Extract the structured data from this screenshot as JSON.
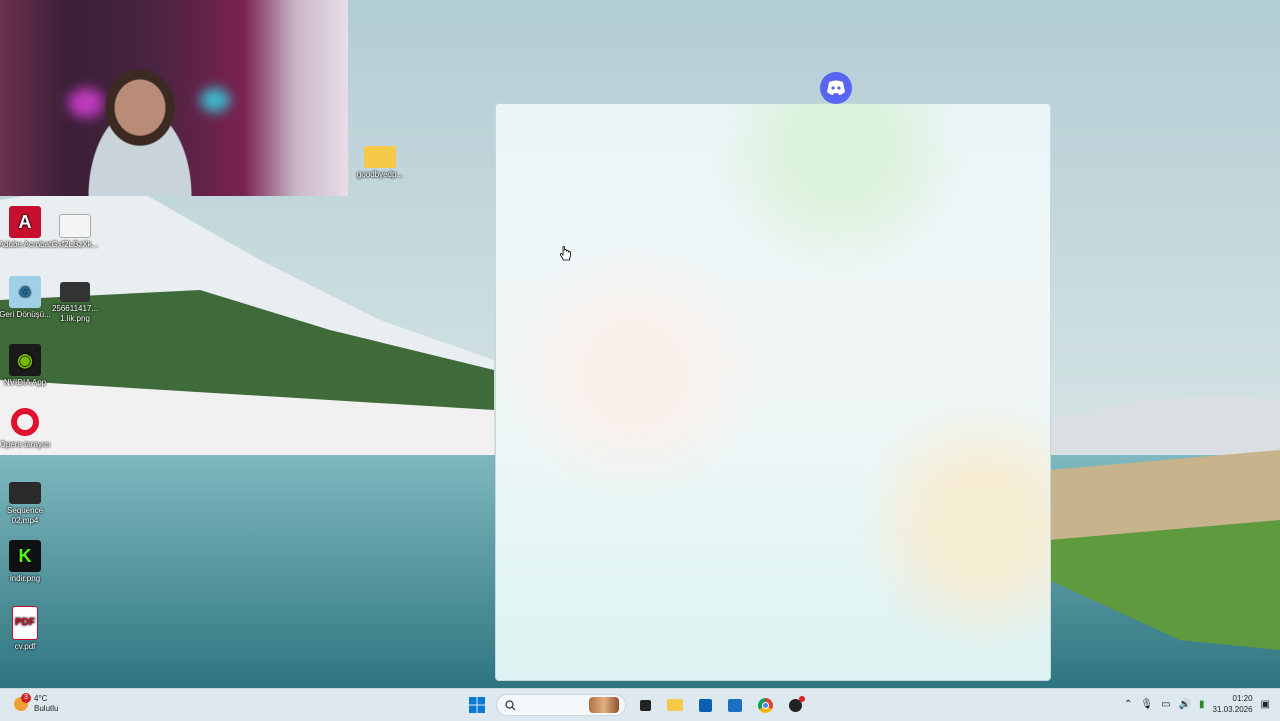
{
  "desktop": {
    "folder": {
      "label": "goodbyedp..."
    },
    "icons": [
      {
        "label": "Adobe Acrobat",
        "icon": "acrobat-icon"
      },
      {
        "label": "Gxf2LBzXk...",
        "icon": "image-file-icon"
      },
      {
        "label": "Geri Dönüşü...",
        "icon": "recycle-bin-icon"
      },
      {
        "label": "256611417... 1.lik.png",
        "icon": "image-file-icon"
      },
      {
        "label": "NVIDIA App",
        "icon": "nvidia-icon"
      },
      {
        "label": "Opera tarayıcı",
        "icon": "opera-icon"
      },
      {
        "label": "Sequence 02.mp4",
        "icon": "video-file-icon"
      },
      {
        "label": "indir.png",
        "icon": "image-file-icon"
      },
      {
        "label": "cv.pdf",
        "icon": "pdf-icon"
      }
    ]
  },
  "weather": {
    "temp": "4°C",
    "condition": "Bulutlu",
    "badge": "3"
  },
  "taskbar": {
    "search_value": "",
    "apps": [
      "start-icon",
      "search-icon",
      "task-view-icon",
      "file-explorer-icon",
      "store-icon",
      "outlook-icon",
      "chrome-icon",
      "app-icon"
    ]
  },
  "clock": {
    "time": "01:20",
    "date": "31.03.2026"
  },
  "colors": {
    "discord": "#5865f2",
    "taskbar": "#dde9ef"
  }
}
